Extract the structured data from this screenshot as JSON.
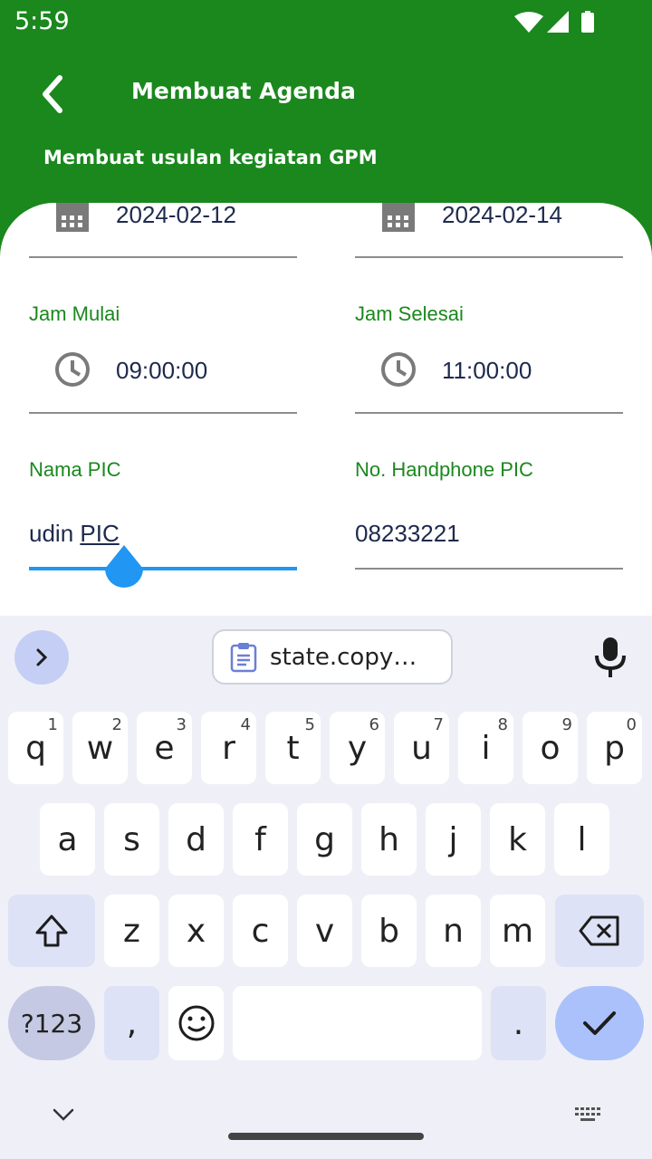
{
  "status": {
    "time": "5:59"
  },
  "header": {
    "title": "Membuat Agenda",
    "subtitle": "Membuat usulan kegiatan GPM"
  },
  "form": {
    "start_date": "2024-02-12",
    "end_date": "2024-02-14",
    "start_time_label": "Jam Mulai",
    "start_time": "09:00:00",
    "end_time_label": "Jam Selesai",
    "end_time": "11:00:00",
    "pic_name_label": "Nama PIC",
    "pic_name_prefix": "udin ",
    "pic_name_underlined": "PIC",
    "pic_phone_label": "No. Handphone PIC",
    "pic_phone": "08233221"
  },
  "keyboard": {
    "clipboard_suggestion": "state.copy…",
    "row1": [
      {
        "k": "q",
        "h": "1"
      },
      {
        "k": "w",
        "h": "2"
      },
      {
        "k": "e",
        "h": "3"
      },
      {
        "k": "r",
        "h": "4"
      },
      {
        "k": "t",
        "h": "5"
      },
      {
        "k": "y",
        "h": "6"
      },
      {
        "k": "u",
        "h": "7"
      },
      {
        "k": "i",
        "h": "8"
      },
      {
        "k": "o",
        "h": "9"
      },
      {
        "k": "p",
        "h": "0"
      }
    ],
    "row2": [
      "a",
      "s",
      "d",
      "f",
      "g",
      "h",
      "j",
      "k",
      "l"
    ],
    "row3": [
      "z",
      "x",
      "c",
      "v",
      "b",
      "n",
      "m"
    ],
    "symbols_label": "?123",
    "comma": ",",
    "period": "."
  },
  "colors": {
    "primary": "#1a881d",
    "text_dark": "#1d2a4d",
    "cursor": "#2196f3"
  }
}
